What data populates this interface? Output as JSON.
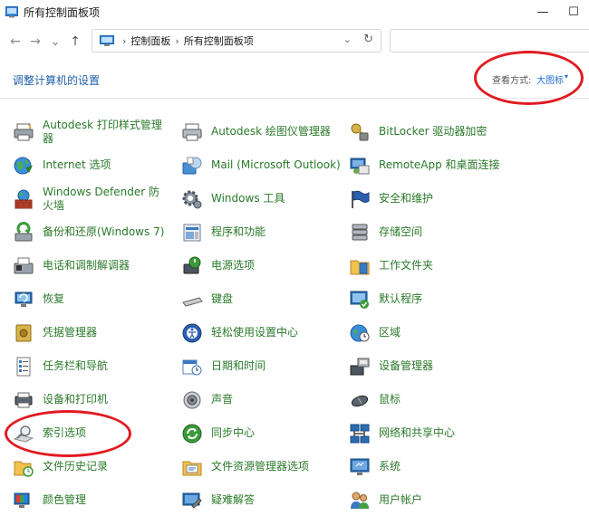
{
  "window": {
    "title": "所有控制面板项",
    "min_glyph": "—",
    "max_glyph": "☐"
  },
  "nav": {
    "back_glyph": "←",
    "forward_glyph": "→",
    "history_glyph": "⌄",
    "up_glyph": "↑"
  },
  "address": {
    "separator": "›",
    "crumbs": [
      "控制面板",
      "所有控制面板项"
    ],
    "dropdown_glyph": "⌄",
    "refresh_glyph": "↻"
  },
  "search": {
    "placeholder": ""
  },
  "header": {
    "page_title": "调整计算机的设置",
    "view_label": "查看方式:",
    "view_value": "大图标",
    "view_caret": "▾"
  },
  "items": [
    [
      "Autodesk 打印样式管理器",
      "Autodesk 绘图仪管理器",
      "BitLocker 驱动器加密"
    ],
    [
      "Internet 选项",
      "Mail (Microsoft Outlook)",
      "RemoteApp 和桌面连接"
    ],
    [
      "Windows Defender 防火墙",
      "Windows 工具",
      "安全和维护"
    ],
    [
      "备份和还原(Windows 7)",
      "程序和功能",
      "存储空间"
    ],
    [
      "电话和调制解调器",
      "电源选项",
      "工作文件夹"
    ],
    [
      "恢复",
      "键盘",
      "默认程序"
    ],
    [
      "凭据管理器",
      "轻松使用设置中心",
      "区域"
    ],
    [
      "任务栏和导航",
      "日期和时间",
      "设备管理器"
    ],
    [
      "设备和打印机",
      "声音",
      "鼠标"
    ],
    [
      "索引选项",
      "同步中心",
      "网络和共享中心"
    ],
    [
      "文件历史记录",
      "文件资源管理器选项",
      "系统"
    ],
    [
      "颜色管理",
      "疑难解答",
      "用户帐户"
    ]
  ],
  "colors": {
    "link_green": "#2a7a2a",
    "title_blue": "#1f5fa8",
    "annotation_red": "#e11b22"
  }
}
